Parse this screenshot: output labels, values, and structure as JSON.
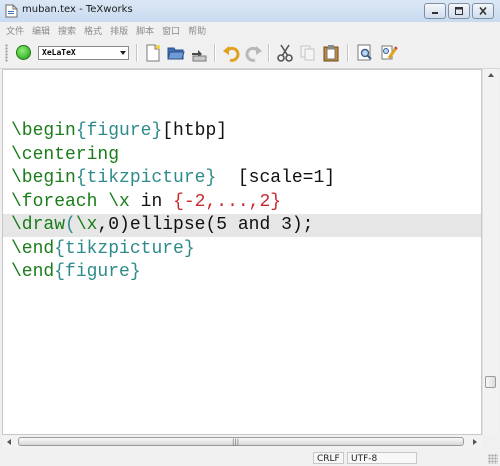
{
  "window": {
    "title": "muban.tex - TeXworks"
  },
  "menu": [
    {
      "id": "file",
      "label": "文件"
    },
    {
      "id": "edit",
      "label": "编辑"
    },
    {
      "id": "search",
      "label": "搜索"
    },
    {
      "id": "format",
      "label": "格式"
    },
    {
      "id": "typeset",
      "label": "排版"
    },
    {
      "id": "scripts",
      "label": "脚本"
    },
    {
      "id": "window",
      "label": "窗口"
    },
    {
      "id": "help",
      "label": "帮助"
    }
  ],
  "toolbar": {
    "engine": "XeLaTeX",
    "icons": [
      "typeset-icon",
      "new-file-icon",
      "open-folder-icon",
      "save-icon",
      "undo-icon",
      "redo-icon",
      "cut-icon",
      "copy-icon",
      "paste-icon",
      "find-icon",
      "replace-icon"
    ]
  },
  "editor": {
    "lines": {
      "l1": {
        "cmd": "\\begin",
        "b1": "{",
        "arg": "figure",
        "b2": "}",
        "rest": "[htbp]"
      },
      "l2": {
        "cmd": "\\centering"
      },
      "l3": {
        "cmd": "\\begin",
        "b1": "{",
        "arg": "tikzpicture",
        "b2": "}",
        "rest": "  [scale=1]"
      },
      "l4": {
        "cmd": "\\foreach",
        "sp": " ",
        "var": "\\x",
        "mid": " in ",
        "b1": "{",
        "range": "-2,...,2",
        "b2": "}"
      },
      "l5": {
        "cmd": "\\draw",
        "p1": "(",
        "var": "\\x",
        "rest1": ",0)ellipse(5 and 3);"
      },
      "l6": {
        "cmd": "\\end",
        "b1": "{",
        "arg": "tikzpicture",
        "b2": "}"
      },
      "l7": {
        "cmd": "\\end",
        "b1": "{",
        "arg": "figure",
        "b2": "}"
      }
    },
    "current_line": 5
  },
  "status": {
    "line_ending": "CRLF",
    "encoding": "UTF-8"
  },
  "colors": {
    "command": "#1a7c1a",
    "brace": "#2e8b8b",
    "range": "#cc2a2a",
    "current_line_bg": "#e6e6e6"
  }
}
